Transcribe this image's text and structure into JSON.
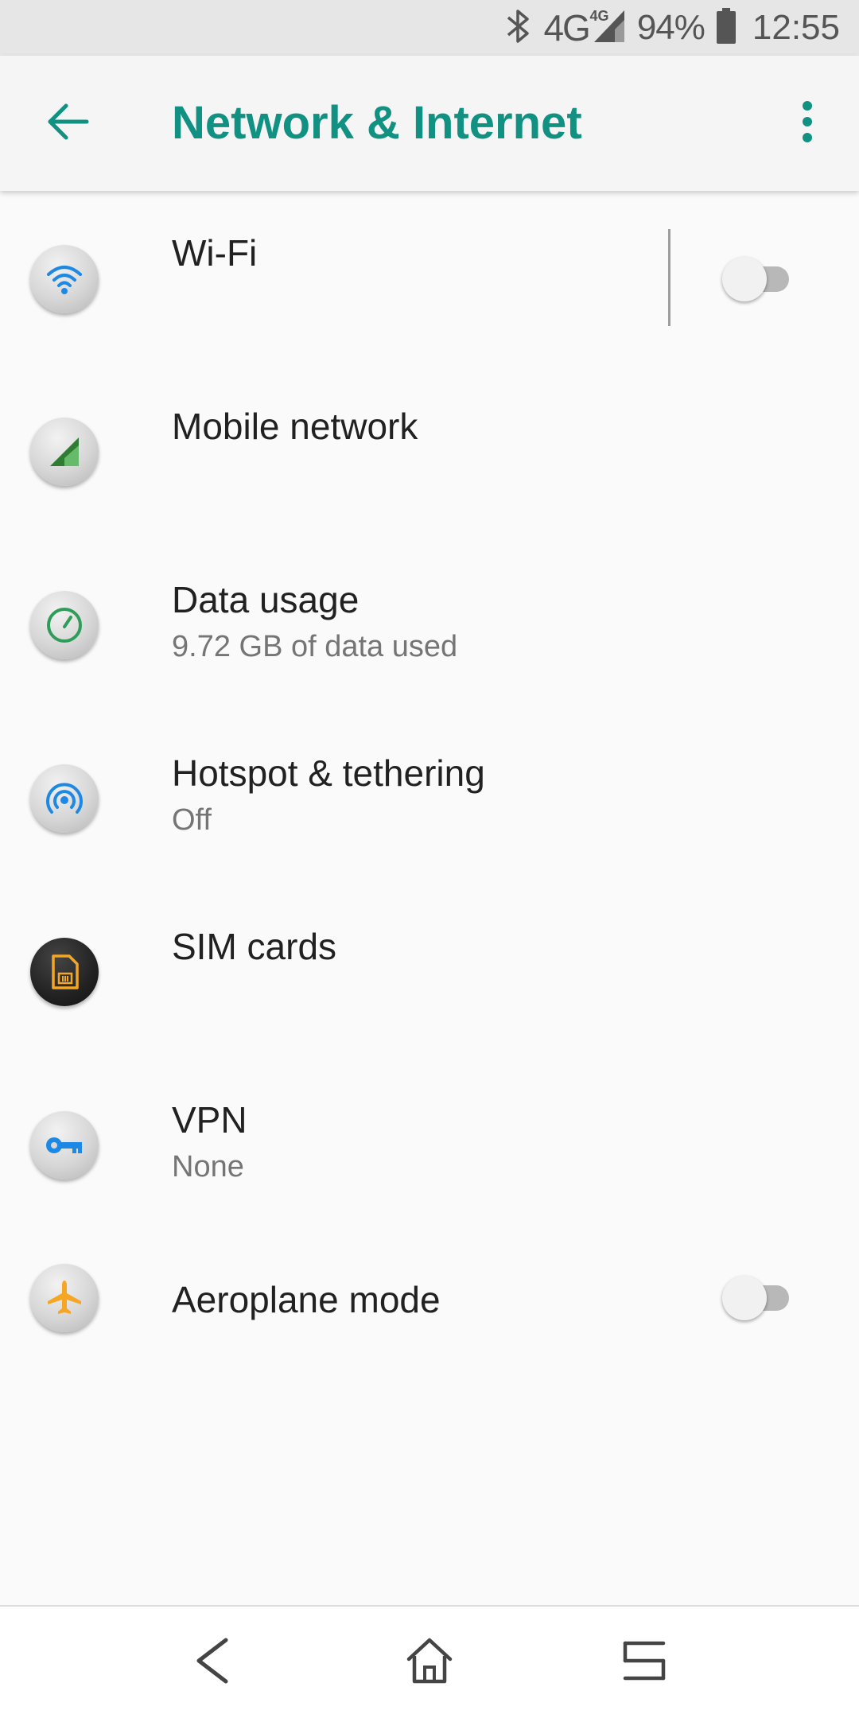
{
  "status_bar": {
    "network_type": "4G",
    "network_type_small": "4G",
    "battery_percent": "94%",
    "time": "12:55",
    "icons": [
      "bluetooth-icon",
      "signal-icon",
      "battery-icon"
    ]
  },
  "app_bar": {
    "title": "Network & Internet",
    "back_icon": "arrow-back-icon",
    "more_icon": "more-vert-icon",
    "accent_color": "#109182"
  },
  "settings": [
    {
      "title": "Wi-Fi",
      "subtitle": "",
      "icon": "wifi-icon",
      "toggle": "off"
    },
    {
      "title": "Mobile network",
      "subtitle": "",
      "icon": "signal-triangle-icon"
    },
    {
      "title": "Data usage",
      "subtitle": "9.72 GB of data used",
      "icon": "data-usage-icon"
    },
    {
      "title": "Hotspot & tethering",
      "subtitle": "Off",
      "icon": "hotspot-icon"
    },
    {
      "title": "SIM cards",
      "subtitle": "",
      "icon": "sim-card-icon"
    },
    {
      "title": "VPN",
      "subtitle": "None",
      "icon": "vpn-key-icon"
    },
    {
      "title": "Aeroplane mode",
      "subtitle": "",
      "icon": "airplane-icon",
      "toggle": "off"
    }
  ],
  "nav_bar": {
    "icons": [
      "nav-back-icon",
      "nav-home-icon",
      "nav-recents-icon"
    ]
  }
}
